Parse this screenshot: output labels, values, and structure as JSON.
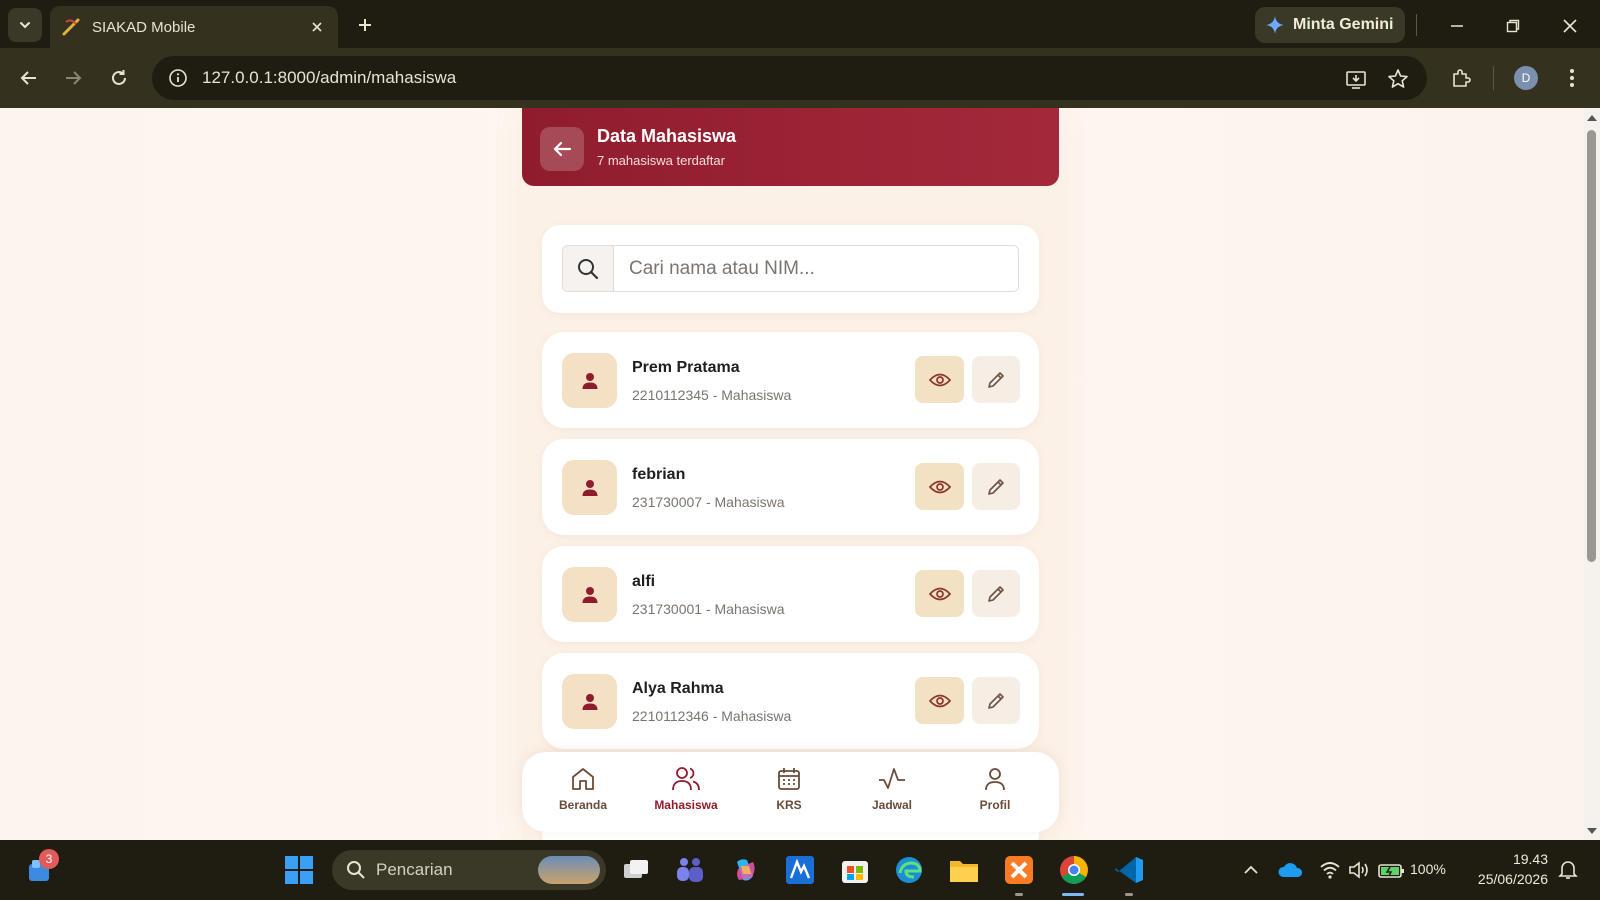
{
  "browser": {
    "tab_title": "SIAKAD Mobile",
    "gemini_label": "Minta Gemini",
    "url": "127.0.0.1:8000/admin/mahasiswa",
    "profile_initial": "D"
  },
  "header": {
    "title": "Data Mahasiswa",
    "subtitle": "7 mahasiswa terdaftar"
  },
  "search": {
    "placeholder": "Cari nama atau NIM..."
  },
  "students": [
    {
      "name": "Prem Pratama",
      "meta": "2210112345 - Mahasiswa"
    },
    {
      "name": "febrian",
      "meta": "231730007 - Mahasiswa"
    },
    {
      "name": "alfi",
      "meta": "231730001 - Mahasiswa"
    },
    {
      "name": "Alya Rahma",
      "meta": "2210112346 - Mahasiswa"
    }
  ],
  "bottom_nav": [
    {
      "label": "Beranda",
      "icon": "home-icon",
      "active": false
    },
    {
      "label": "Mahasiswa",
      "icon": "users-icon",
      "active": true
    },
    {
      "label": "KRS",
      "icon": "calendar-icon",
      "active": false
    },
    {
      "label": "Jadwal",
      "icon": "activity-icon",
      "active": false
    },
    {
      "label": "Profil",
      "icon": "user-icon",
      "active": false
    }
  ],
  "taskbar": {
    "notification_count": "3",
    "search_text": "Pencarian",
    "battery": "100%",
    "time": "19.43",
    "date": "25/06/2026"
  },
  "colors": {
    "brand": "#8f1c2d",
    "accent_soft": "#f3e1c4",
    "page_bg": "#fcf1e7"
  }
}
